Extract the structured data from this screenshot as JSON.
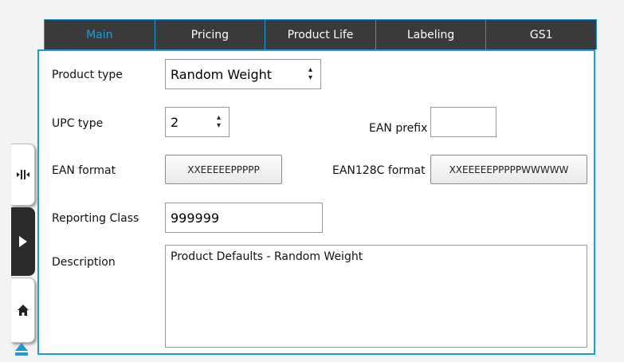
{
  "tabs": [
    {
      "label": "Main",
      "active": true
    },
    {
      "label": "Pricing"
    },
    {
      "label": "Product Life"
    },
    {
      "label": "Labeling"
    },
    {
      "label": "GS1"
    }
  ],
  "form": {
    "product_type_label": "Product type",
    "product_type_value": "Random Weight",
    "upc_type_label": "UPC type",
    "upc_type_value": "2",
    "ean_prefix_label": "EAN prefix",
    "ean_prefix_value": "",
    "ean_format_label": "EAN format",
    "ean_format_value": "XXEEEEEPPPPP",
    "ean128c_format_label": "EAN128C format",
    "ean128c_format_value": "XXEEEEEPPPPPWWWWW",
    "reporting_class_label": "Reporting Class",
    "reporting_class_value": "999999",
    "description_label": "Description",
    "description_value": "Product Defaults - Random Weight"
  },
  "colors": {
    "accent": "#1f9ad6",
    "tab_bg": "#3a3a3a",
    "sidebar_dark": "#2b2b2b"
  },
  "sidebar_icons": [
    "collapse-icon",
    "play-icon",
    "home-icon",
    "eject-icon"
  ]
}
